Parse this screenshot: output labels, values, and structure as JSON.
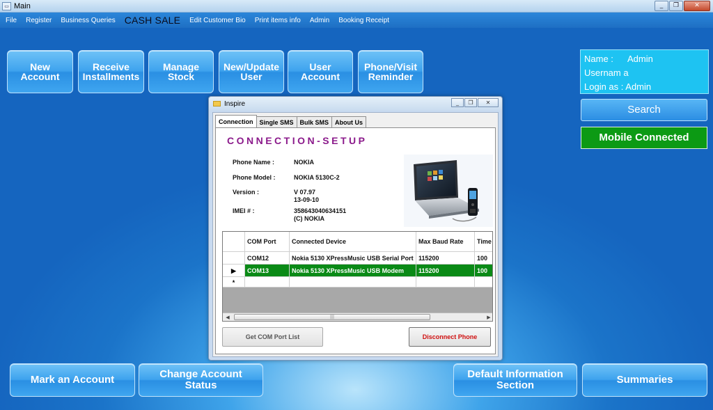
{
  "window": {
    "title": "Main",
    "controls": {
      "minimize": "_",
      "restore": "❐",
      "close": "✕"
    }
  },
  "menu": {
    "items": [
      "File",
      "Register",
      "Business Queries",
      "CASH SALE",
      "Edit Customer Bio",
      "Print items info",
      "Admin",
      "Booking Receipt"
    ]
  },
  "tiles": [
    {
      "line1": "New",
      "line2": "Account"
    },
    {
      "line1": "Receive",
      "line2": "Installments"
    },
    {
      "line1": "Manage",
      "line2": "Stock"
    },
    {
      "line1": "New/Update",
      "line2": "User"
    },
    {
      "line1": "User",
      "line2": "Account"
    },
    {
      "line1": "Phone/Visit",
      "line2": "Reminder"
    }
  ],
  "info_panel": {
    "name_label": "Name :",
    "name_value": "Admin",
    "username_label": "Usernam a",
    "username_value": "",
    "login_label": "Login as :",
    "login_value": "Admin"
  },
  "search_label": "Search",
  "mobile_status": "Mobile Connected",
  "dialog": {
    "title": "Inspire",
    "tabs": [
      "Connection",
      "Single SMS",
      "Bulk SMS",
      "About Us"
    ],
    "heading": "CONNECTION-SETUP",
    "fields": {
      "phone_name_label": "Phone Name :",
      "phone_name_value": "NOKIA",
      "phone_model_label": "Phone Model :",
      "phone_model_value": "NOKIA 5130C-2",
      "version_label": "Version :",
      "version_line1": "V 07.97",
      "version_line2": "13-09-10",
      "imei_label": "IMEI # :",
      "imei_line1": "358643040634151",
      "imei_line2": "(C) NOKIA"
    },
    "grid": {
      "headers": {
        "com": "COM Port",
        "device": "Connected Device",
        "baud": "Max Baud Rate",
        "timeout": "Time Out"
      },
      "rows": [
        {
          "marker": "",
          "com": "COM12",
          "device": "Nokia 5130 XPressMusic USB Serial Port",
          "baud": "115200",
          "timeout": "100"
        },
        {
          "marker": "▶",
          "com": "COM13",
          "device": "Nokia 5130 XPressMusic USB Modem",
          "baud": "115200",
          "timeout": "100"
        }
      ],
      "new_row_marker": "*",
      "scroll_left": "◀",
      "scroll_right": "▶",
      "scroll_grip": "|||"
    },
    "get_com_label": "Get COM Port List",
    "disconnect_label": "Disconnect Phone"
  },
  "bottom_buttons": [
    {
      "line1": "Mark an Account",
      "line2": ""
    },
    {
      "line1": "Change Account",
      "line2": "Status"
    },
    {
      "line1": "Default Information",
      "line2": "Section"
    },
    {
      "line1": "Summaries",
      "line2": ""
    }
  ]
}
